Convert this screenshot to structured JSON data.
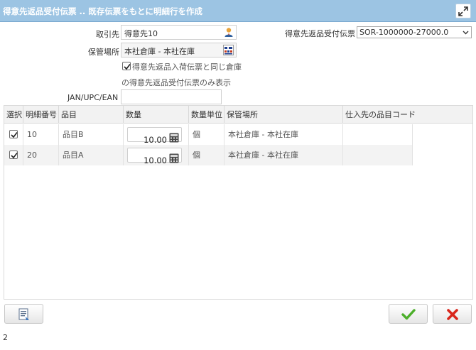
{
  "window": {
    "title": "得意先返品受付伝票 .. 既存伝票をもとに明細行を作成"
  },
  "form": {
    "customer_label": "取引先",
    "customer_value": "得意先10",
    "warehouse_label": "保管場所",
    "warehouse_value": "本社倉庫 - 本社在庫",
    "same_warehouse_label_line1": "得意先返品入荷伝票と同じ倉庫",
    "same_warehouse_label_line2": "の得意先返品受付伝票のみ表示",
    "same_warehouse_checked": true,
    "jan_label": "JAN/UPC/EAN",
    "jan_value": "",
    "receipt_label": "得意先返品受付伝票",
    "receipt_value": "SOR-1000000-27000.0"
  },
  "table": {
    "columns": [
      "選択",
      "明細番号",
      "品目",
      "数量",
      "数量単位",
      "保管場所",
      "仕入先の品目コード"
    ],
    "rows": [
      {
        "selected": true,
        "line_no": "10",
        "item": "品目B",
        "qty": "10.00",
        "uom": "個",
        "location": "本社倉庫 - 本社在庫",
        "vendor_code": ""
      },
      {
        "selected": true,
        "line_no": "20",
        "item": "品目A",
        "qty": "10.00",
        "uom": "個",
        "location": "本社倉庫 - 本社在庫",
        "vendor_code": ""
      }
    ]
  },
  "footer": {
    "count": "2"
  },
  "icons": {
    "maximize": "maximize-icon",
    "customer_lookup": "person-icon",
    "warehouse_lookup": "warehouse-icon",
    "calculator": "calculator-icon",
    "report": "report-icon",
    "ok": "checkmark-icon",
    "cancel": "x-icon"
  },
  "colors": {
    "titlebar": "#9cc4e3",
    "ok_green": "#4caf2a",
    "cancel_red": "#d9261c"
  }
}
